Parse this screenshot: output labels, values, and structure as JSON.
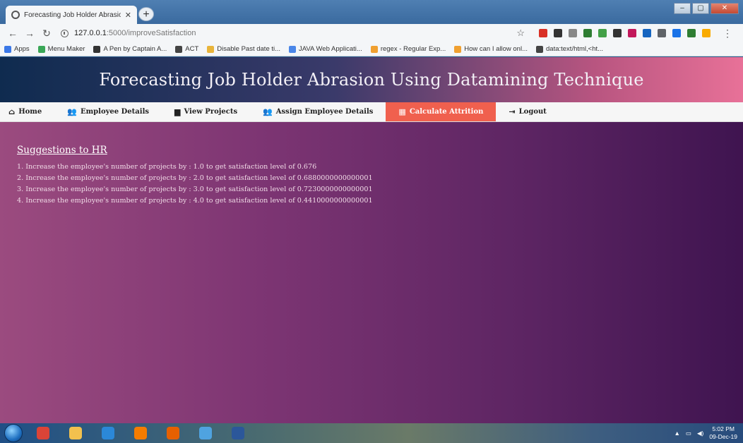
{
  "browser": {
    "tab_title": "Forecasting Job Holder Abrasion",
    "tab_close": "✕",
    "new_tab": "+",
    "url_host": "127.0.0.1",
    "url_rest": ":5000/improveSatisfaction",
    "window_controls": [
      "–",
      "▢",
      "✕"
    ],
    "bookmarks": [
      {
        "label": "Apps",
        "color": "#3b78e7"
      },
      {
        "label": "Menu Maker",
        "color": "#3aa757"
      },
      {
        "label": "A Pen by Captain A...",
        "color": "#333333"
      },
      {
        "label": "ACT",
        "color": "#444444"
      },
      {
        "label": "Disable Past date ti...",
        "color": "#e8b43a"
      },
      {
        "label": "JAVA Web Applicati...",
        "color": "#4a86e8"
      },
      {
        "label": "regex - Regular Exp...",
        "color": "#f0a030"
      },
      {
        "label": "How can I allow onl...",
        "color": "#f0a030"
      },
      {
        "label": "data:text/html,<ht...",
        "color": "#444444"
      }
    ],
    "extension_colors": [
      "#d93025",
      "#333333",
      "#888888",
      "#2e7d32",
      "#43a047",
      "#333333",
      "#c2185b",
      "#1565c0",
      "#5f6368",
      "#1a73e8",
      "#2e7d32",
      "#f9ab00"
    ]
  },
  "header": {
    "title": "Forecasting Job Holder Abrasion Using Datamining Technique"
  },
  "nav": {
    "items": [
      {
        "label": "Home",
        "icon": "home-icon",
        "glyph": "⌂",
        "active": false
      },
      {
        "label": "Employee Details",
        "icon": "users-icon",
        "glyph": "👥",
        "active": false
      },
      {
        "label": "View Projects",
        "icon": "file-icon",
        "glyph": "▆",
        "active": false
      },
      {
        "label": "Assign Employee Details",
        "icon": "users-icon",
        "glyph": "👥",
        "active": false
      },
      {
        "label": "Calculate Attrition",
        "icon": "calculator-icon",
        "glyph": "▦",
        "active": true
      },
      {
        "label": "Logout",
        "icon": "logout-icon",
        "glyph": "⇥",
        "active": false
      }
    ],
    "active_color": "#f0604e"
  },
  "main": {
    "heading": "Suggestions to HR",
    "suggestions": [
      "1. Increase the employee's number of projects by : 1.0 to get satisfaction level of 0.676",
      "2. Increase the employee's number of projects by : 2.0 to get satisfaction level of 0.6880000000000001",
      "3. Increase the employee's number of projects by : 3.0 to get satisfaction level of 0.7230000000000001",
      "4. Increase the employee's number of projects by : 4.0 to get satisfaction level of 0.4410000000000001"
    ]
  },
  "taskbar": {
    "time": "5:02 PM",
    "date": "09-Dec-19",
    "apps": [
      {
        "name": "chrome-icon",
        "color": "#db4437"
      },
      {
        "name": "file-explorer-icon",
        "color": "#f2c14e"
      },
      {
        "name": "vscode-icon",
        "color": "#2b88d8"
      },
      {
        "name": "vlc-icon",
        "color": "#f57c00"
      },
      {
        "name": "firefox-icon",
        "color": "#e66000"
      },
      {
        "name": "app-icon",
        "color": "#4fa3e0"
      },
      {
        "name": "word-icon",
        "color": "#2b579a"
      }
    ]
  }
}
